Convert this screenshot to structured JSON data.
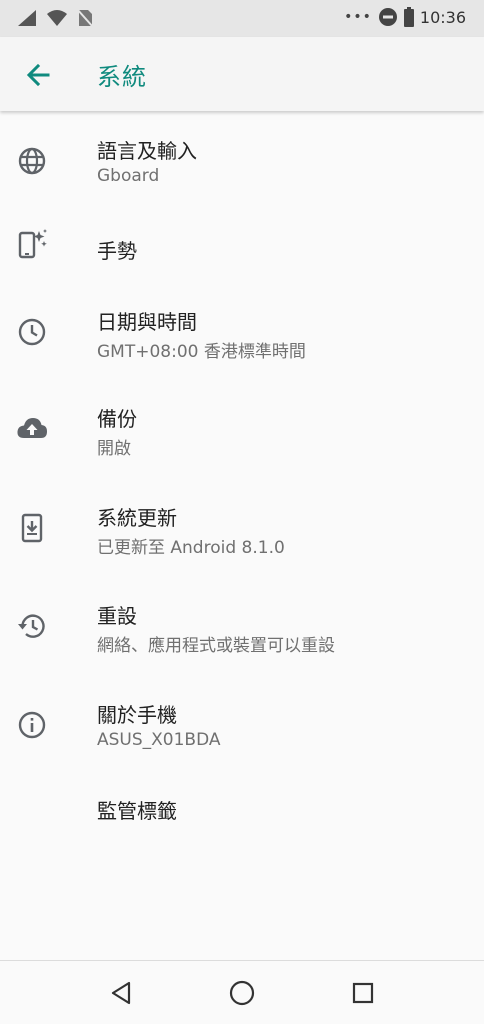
{
  "status_bar": {
    "time": "10:36"
  },
  "app_bar": {
    "title": "系統"
  },
  "items": [
    {
      "title": "語言及輸入",
      "subtitle": "Gboard",
      "icon": "globe-icon"
    },
    {
      "title": "手勢",
      "subtitle": "",
      "icon": "phone-gesture-icon"
    },
    {
      "title": "日期與時間",
      "subtitle": "GMT+08:00 香港標準時間",
      "icon": "clock-icon"
    },
    {
      "title": "備份",
      "subtitle": "開啟",
      "icon": "cloud-upload-icon"
    },
    {
      "title": "系統更新",
      "subtitle": "已更新至 Android 8.1.0",
      "icon": "system-update-icon"
    },
    {
      "title": "重設",
      "subtitle": "網絡、應用程式或裝置可以重設",
      "icon": "restore-icon"
    },
    {
      "title": "關於手機",
      "subtitle": "ASUS_X01BDA",
      "icon": "info-icon"
    },
    {
      "title": "監管標籤",
      "subtitle": "",
      "icon": ""
    }
  ],
  "colors": {
    "accent": "#0f8a7e",
    "icon": "#5f6368",
    "title": "#222222",
    "subtitle": "#707070"
  }
}
